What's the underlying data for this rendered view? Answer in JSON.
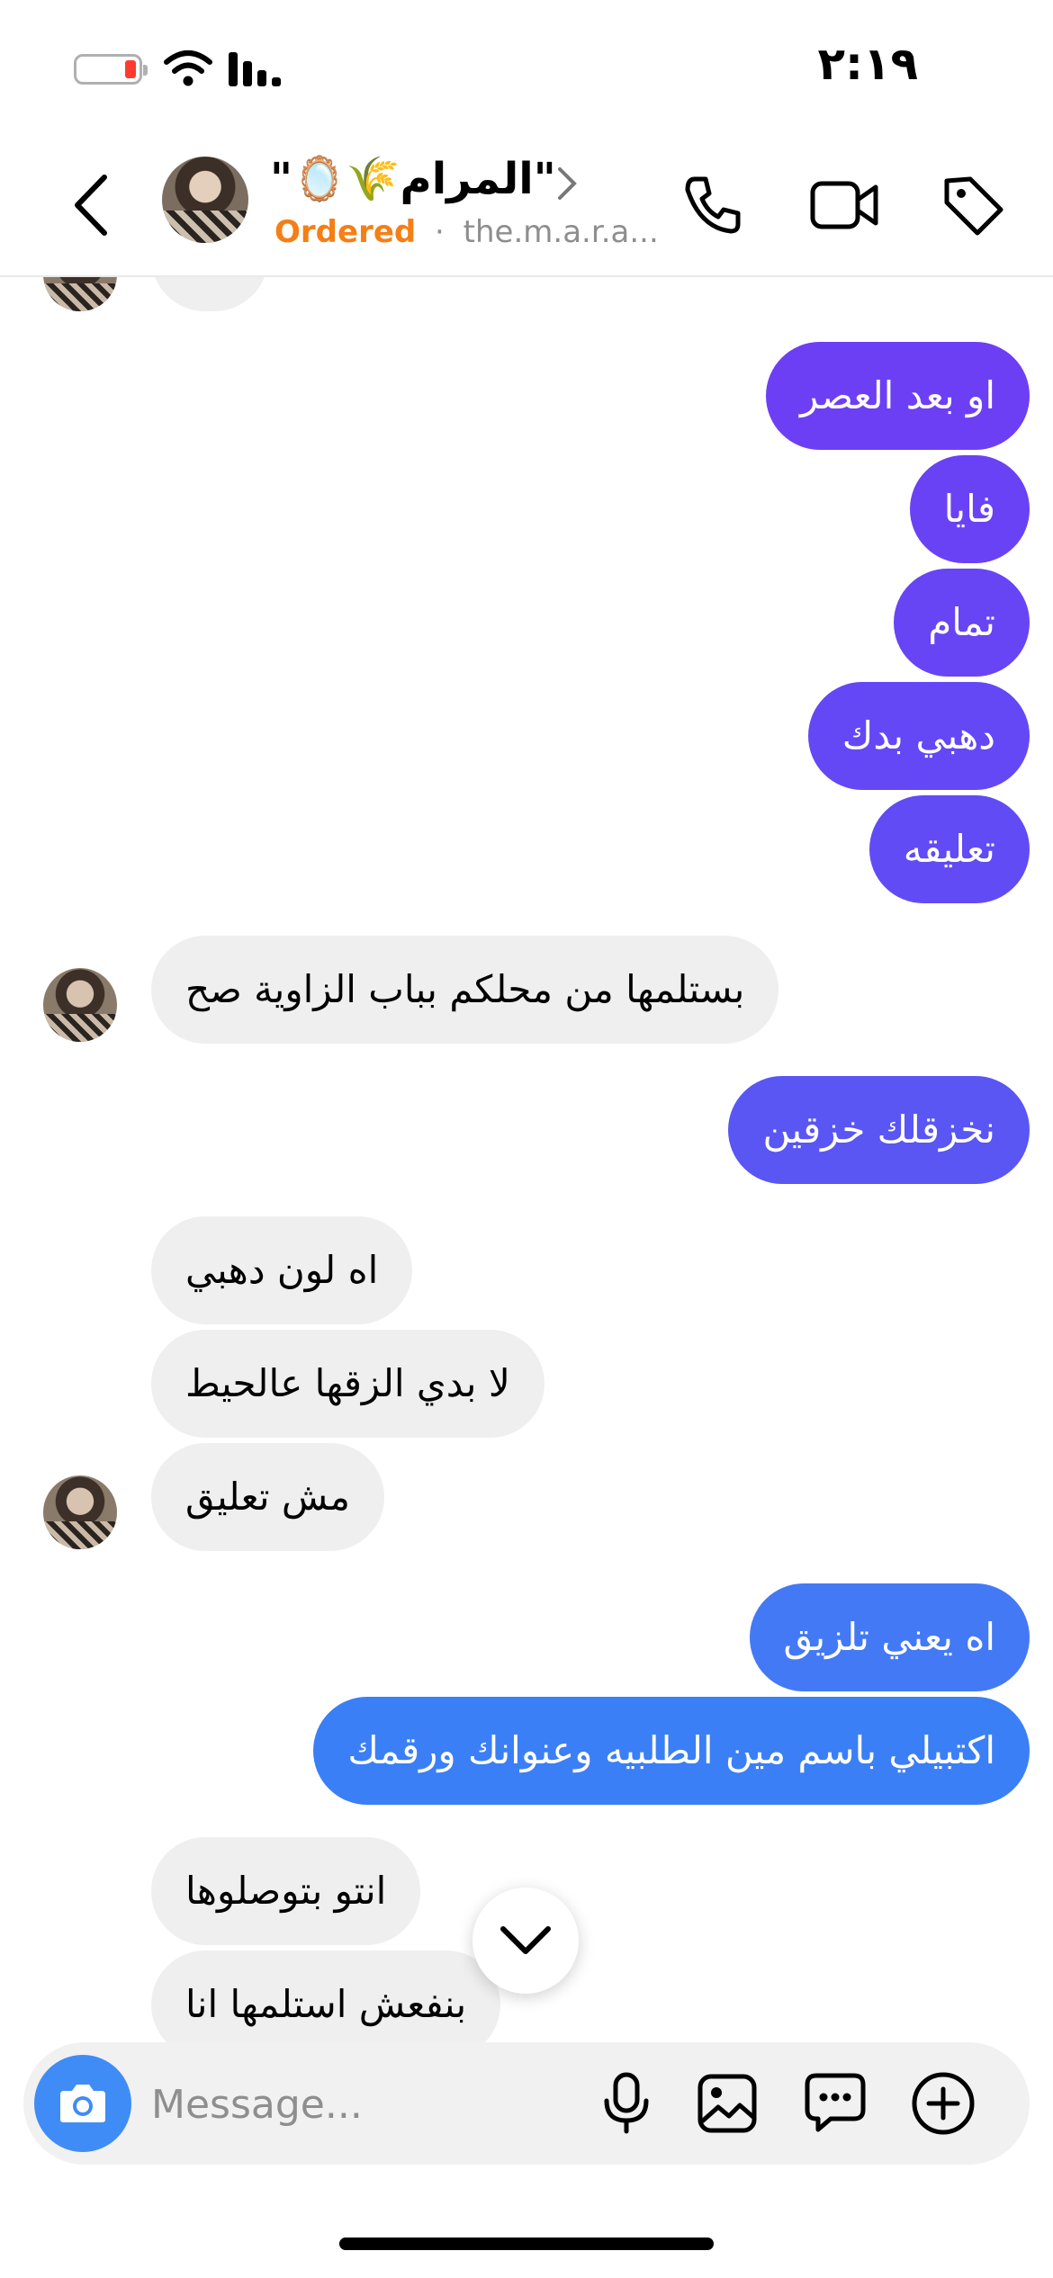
{
  "status_bar": {
    "time": "٢:١٩"
  },
  "header": {
    "contact_name": "\"🪞🌾المرام\"",
    "ordered_label": "Ordered",
    "separator": "·",
    "handle": "the.m.a.r.a..."
  },
  "messages": [
    {
      "side": "out",
      "text": "او بعد العصر"
    },
    {
      "side": "out",
      "text": "فايا"
    },
    {
      "side": "out",
      "text": "تمام"
    },
    {
      "side": "out",
      "text": "دهبي بدك"
    },
    {
      "side": "out",
      "text": "تعليقه"
    },
    {
      "side": "in",
      "text": "بستلمها من محلكم بباب الزاوية صح"
    },
    {
      "side": "out",
      "text": "نخزقلك خزقين"
    },
    {
      "side": "in",
      "text": "اه لون دهبي"
    },
    {
      "side": "in",
      "text": "لا بدي الزقها عالحيط"
    },
    {
      "side": "in",
      "text": "مش تعليق"
    },
    {
      "side": "out",
      "text": "اه يعني تلزيق"
    },
    {
      "side": "out",
      "text": "اكتبيلي باسم مين الطلبيه وعنوانك ورقمك"
    },
    {
      "side": "in",
      "text": "انتو بتوصلوها"
    },
    {
      "side": "in",
      "text": "بنفعش استلمها انا"
    }
  ],
  "composer": {
    "placeholder": "Message..."
  },
  "icons": {
    "back": "chevron-left-icon",
    "call": "phone-icon",
    "video": "video-camera-icon",
    "tag": "tag-icon",
    "camera": "camera-icon",
    "mic": "microphone-icon",
    "gallery": "image-icon",
    "sticker": "chat-bubble-icon",
    "add": "plus-circle-icon",
    "scroll": "chevron-down-icon"
  },
  "colors": {
    "out_purple": "#6c3ff5",
    "out_indigo": "#5956f4",
    "out_blue": "#3b7ff6",
    "incoming": "#efefef",
    "ordered": "#f57f17",
    "camera": "#3f8cf6"
  }
}
